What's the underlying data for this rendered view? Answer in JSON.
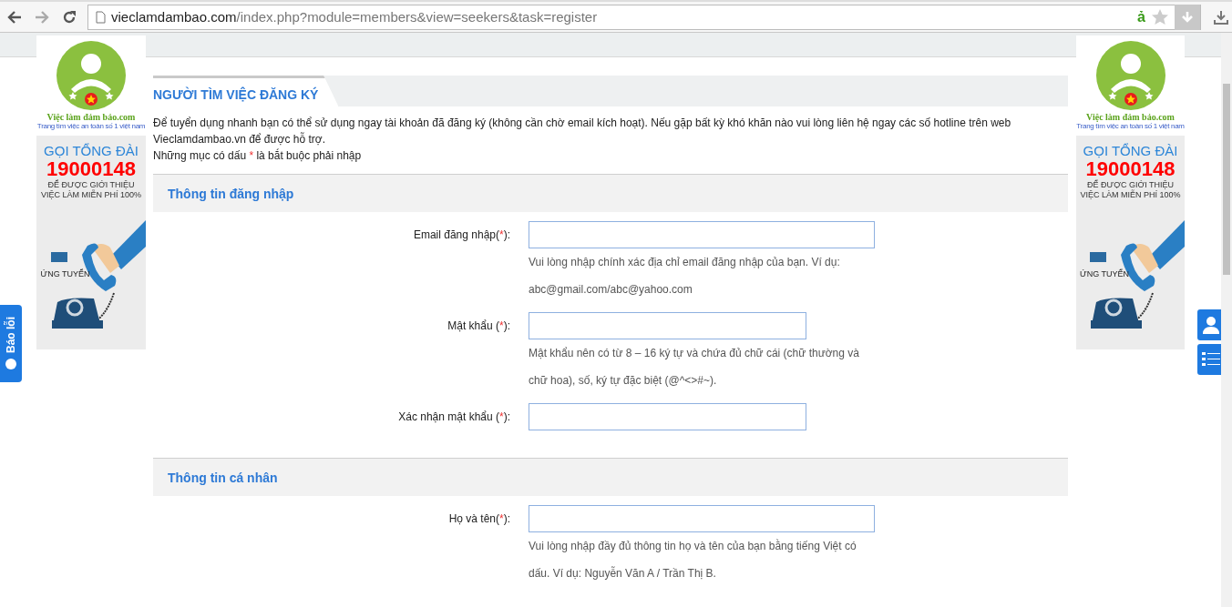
{
  "browser": {
    "url_domain": "vieclamdambao.com",
    "url_path": "/index.php?module=members&view=seekers&task=register",
    "extension_glyph": "ả"
  },
  "ads": [
    {
      "logo_name": "Việc làm đảm bảo.com",
      "logo_slogan": "Trang tìm việc an toàn số 1 việt nam",
      "call": "GỌI TỔNG ĐÀI",
      "phone": "19000148",
      "promo_1": "ĐỂ ĐƯỢC GIỚI THIỆU",
      "promo_2": "VIỆC LÀM MIỄN PHÍ 100%",
      "apply": "ỨNG TUYỂN"
    },
    {
      "logo_name": "Việc làm đảm bảo.com",
      "logo_slogan": "Trang tìm việc an toàn số 1 việt nam",
      "call": "GỌI TỔNG ĐÀI",
      "phone": "19000148",
      "promo_1": "ĐỂ ĐƯỢC GIỚI THIỆU",
      "promo_2": "VIỆC LÀM MIỄN PHÍ 100%",
      "apply": "ỨNG TUYỂN"
    }
  ],
  "report_tab": "Báo lỗi",
  "title": "NGƯỜI TÌM VIỆC ĐĂNG KÝ",
  "intro": "Để tuyển dụng nhanh bạn có thể sử dụng ngay tài khoản đã đăng ký (không cần chờ email kích hoạt). Nếu gặp bất kỳ khó khăn nào vui lòng liên hệ ngay các số hotline trên web Vieclamdambao.vn để được hỗ trợ.",
  "required_note": {
    "before": "Những mục có dấu ",
    "mark": "*",
    "after": " là bắt buộc phải nhập"
  },
  "sections": [
    {
      "title": "Thông tin đăng nhập",
      "fields": [
        {
          "label": "Email đăng nhập(",
          "mark": "*",
          "label_end": "):",
          "kind": "long",
          "hint": "Vui lòng nhập chính xác địa chỉ email đăng nhập của bạn. Ví dụ: abc@gmail.com/abc@yahoo.com"
        },
        {
          "label": "Mật khẩu (",
          "mark": "*",
          "label_end": "):",
          "kind": "short",
          "hint": "Mật khẩu nên có từ 8 – 16 ký tự và chứa đủ chữ cái (chữ thường và chữ hoa), số, ký tự đặc biệt (@^<>#~)."
        },
        {
          "label": "Xác nhận mật khẩu (",
          "mark": "*",
          "label_end": "):",
          "kind": "short"
        }
      ]
    },
    {
      "title": "Thông tin cá nhân",
      "fields": [
        {
          "label": "Họ và tên(",
          "mark": "*",
          "label_end": "):",
          "kind": "long",
          "hint": "Vui lòng nhập đầy đủ thông tin họ và tên của bạn bằng tiếng Việt có dấu. Ví dụ: Nguyễn Văn A / Trần Thị B."
        }
      ]
    }
  ]
}
